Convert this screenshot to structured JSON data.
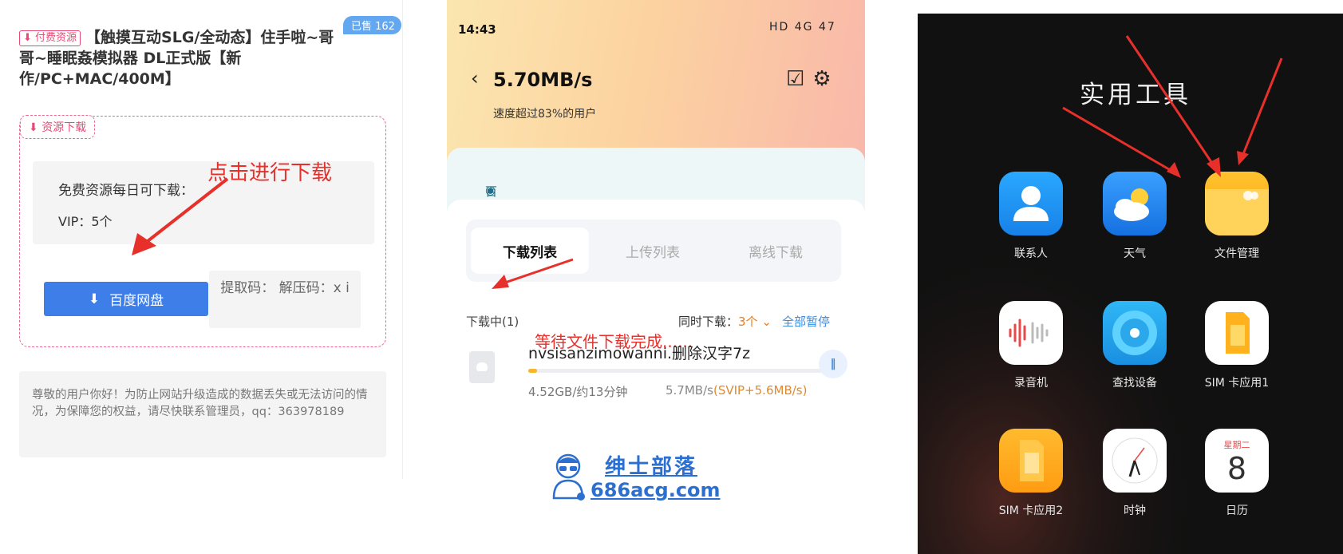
{
  "panel1": {
    "tag": "付费资源",
    "title": "【触摸互动SLG/全动态】住手啦~哥哥~睡眠姦模拟器 DL正式版【新作/PC+MAC/400M】",
    "sold_badge": "已售 162",
    "download_tag": "资源下载",
    "free_text": "免费资源每日可下载：",
    "vip_text": "VIP：5个",
    "annotation": "点击进行下载",
    "baidu_button": "百度网盘",
    "code_text": "提取码：    解压码：x    i",
    "notice": "尊敬的用户你好！为防止网站升级造成的数据丢失或无法访问的情况，为保障您的权益，请尽快联系管理员，qq：363978189"
  },
  "panel2": {
    "status_time": "14:43",
    "status_right": "HD 4G 47",
    "speed": "5.70MB/s",
    "speed_sub": "速度超过83%的用户",
    "secure_text": "百度网盘保障你的传输安全 〉",
    "tabs": [
      "下载列表",
      "上传列表",
      "离线下载"
    ],
    "downloading": "下载中(1)",
    "simultaneous_label": "同时下载：",
    "simultaneous_value": "3个 ⌄",
    "pause_all": "全部暂停",
    "annotation": "等待文件下载完成......",
    "file_name": "nvsisanzimowanni.删除汉字7z",
    "file_progress": 0.03,
    "file_size": "4.52GB/约13分钟",
    "file_rate": "5.7MB/s",
    "file_rate_boost": "(SVIP+5.6MB/s)",
    "watermark_title": "绅士部落",
    "watermark_url": "686acg.com"
  },
  "panel3": {
    "title": "实用工具",
    "apps": [
      {
        "label": "联系人"
      },
      {
        "label": "天气"
      },
      {
        "label": "文件管理"
      },
      {
        "label": "录音机"
      },
      {
        "label": "查找设备"
      },
      {
        "label": "SIM 卡应用1"
      },
      {
        "label": "SIM 卡应用2"
      },
      {
        "label": "时钟"
      },
      {
        "label": "日历"
      }
    ],
    "calendar_weekday": "星期二",
    "calendar_day": "8"
  },
  "colors": {
    "pink": "#e84a75",
    "blue_button": "#3d7ee8",
    "annotation_red": "#e8302b"
  }
}
